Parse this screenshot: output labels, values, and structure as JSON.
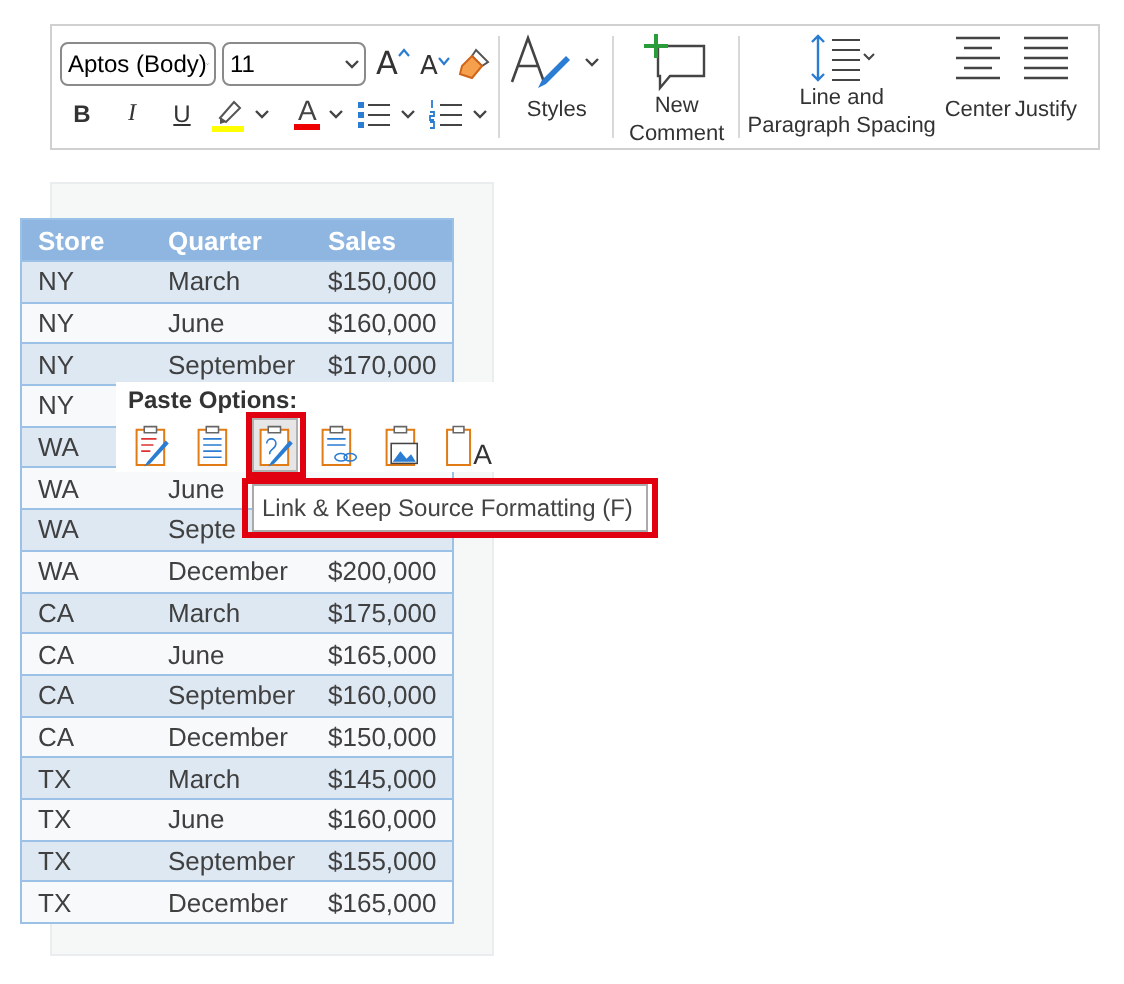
{
  "ribbon": {
    "font_field": {
      "value": "Aptos (Body)"
    },
    "size_field": {
      "value": "11"
    },
    "format_buttons": [
      {
        "kind": "bold",
        "label": "B"
      },
      {
        "kind": "italic",
        "label": "I"
      },
      {
        "kind": "underline",
        "label": "U"
      }
    ],
    "grow_font": {
      "glyph": "A"
    },
    "shrink_font": {
      "glyph": "A"
    },
    "font_color": {
      "glyph": "A"
    },
    "commands": [
      {
        "kind": "styles",
        "label": "Styles"
      },
      {
        "kind": "comment",
        "label": "New Comment"
      },
      {
        "kind": "spacing",
        "label": "Line and Paragraph Spacing"
      },
      {
        "kind": "center",
        "label": "Center"
      },
      {
        "kind": "justify",
        "label": "Justify"
      }
    ]
  },
  "table": {
    "columns": [
      "Store",
      "Quarter",
      "Sales"
    ],
    "rows": [
      [
        "NY",
        "March",
        "$150,000"
      ],
      [
        "NY",
        "June",
        "$160,000"
      ],
      [
        "NY",
        "September",
        "$170,000"
      ],
      [
        "NY"
      ],
      [
        "WA"
      ],
      [
        "WA",
        "June"
      ],
      [
        "WA",
        "Septe"
      ],
      [
        "WA",
        "December",
        "$200,000"
      ],
      [
        "CA",
        "March",
        "$175,000"
      ],
      [
        "CA",
        "June",
        "$165,000"
      ],
      [
        "CA",
        "September",
        "$160,000"
      ],
      [
        "CA",
        "December",
        "$150,000"
      ],
      [
        "TX",
        "March",
        "$145,000"
      ],
      [
        "TX",
        "June",
        "$160,000"
      ],
      [
        "TX",
        "September",
        "$155,000"
      ],
      [
        "TX",
        "December",
        "$165,000"
      ]
    ]
  },
  "paste_options": {
    "title": "Paste Options:",
    "options": [
      {
        "kind": "keep",
        "selected": false
      },
      {
        "kind": "merge",
        "selected": false
      },
      {
        "kind": "link_keep",
        "selected": true
      },
      {
        "kind": "link",
        "selected": false
      },
      {
        "kind": "picture",
        "selected": false
      },
      {
        "kind": "text",
        "selected": false,
        "glyph": "A"
      }
    ],
    "tooltip": "Link & Keep Source Formatting (F)"
  }
}
